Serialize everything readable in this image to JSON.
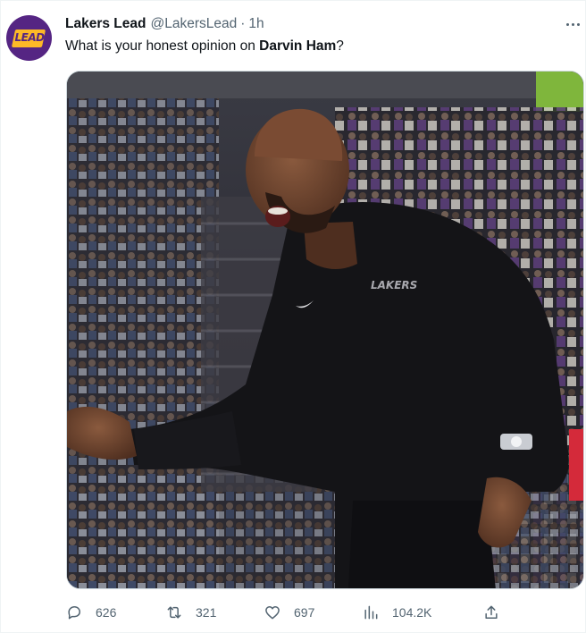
{
  "tweet": {
    "display_name": "Lakers Lead",
    "handle": "@LakersLead",
    "separator": "·",
    "time": "1h",
    "text_before": "What is your honest opinion on ",
    "text_bold": "Darvin Ham",
    "text_after": "?",
    "avatar_text": "LEAD",
    "jersey_logo_text": "LAKERS"
  },
  "actions": {
    "replies": "626",
    "retweets": "321",
    "likes": "697",
    "views": "104.2K"
  },
  "icons": {
    "more": "more-horizontal-icon",
    "reply": "reply-icon",
    "retweet": "retweet-icon",
    "like": "heart-icon",
    "views": "views-chart-icon",
    "share": "share-icon"
  },
  "colors": {
    "lakers_purple": "#552583",
    "lakers_gold": "#fdb927",
    "secondary_text": "#536471",
    "primary_text": "#0f1419"
  }
}
